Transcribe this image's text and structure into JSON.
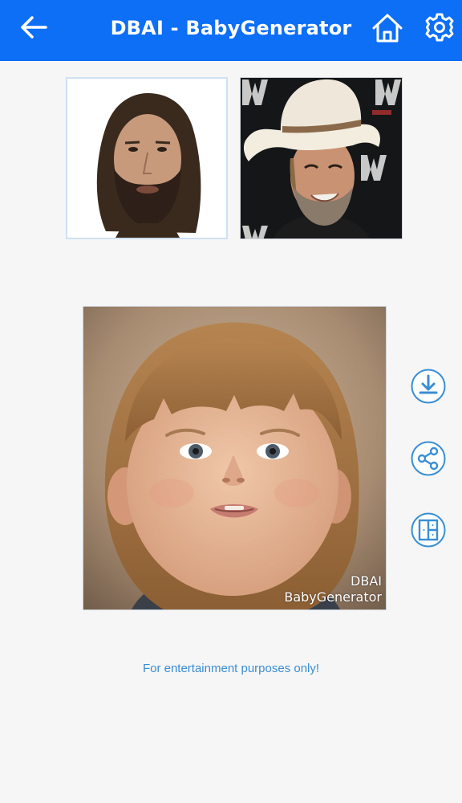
{
  "header": {
    "title": "DBAI - BabyGenerator",
    "back_icon": "arrow-left-icon",
    "home_icon": "home-icon",
    "settings_icon": "gear-icon",
    "background_color": "#0d6ef6"
  },
  "parents": [
    {
      "label": "parent-photo-1",
      "description": "long-haired bearded man on white background"
    },
    {
      "label": "parent-photo-2",
      "description": "smiling man in white cowboy hat"
    }
  ],
  "result": {
    "watermark_line1": "DBAI",
    "watermark_line2": "BabyGenerator"
  },
  "actions": [
    {
      "name": "download",
      "icon": "download-icon"
    },
    {
      "name": "share",
      "icon": "share-icon"
    },
    {
      "name": "compare",
      "icon": "compare-layout-icon"
    }
  ],
  "footer": {
    "disclaimer": "For entertainment purposes only!",
    "accent_color": "#3a8ed4"
  }
}
